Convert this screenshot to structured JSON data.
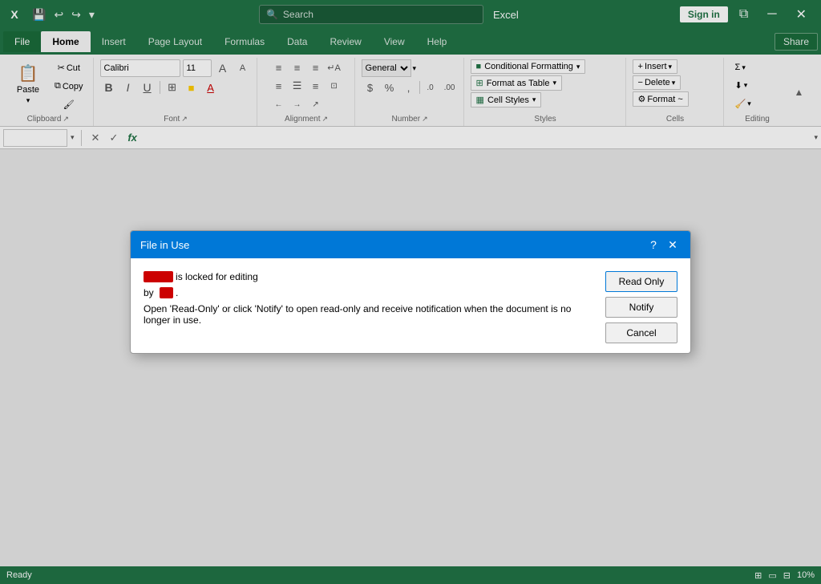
{
  "titlebar": {
    "app_name": "Excel",
    "save_icon": "💾",
    "undo_icon": "↩",
    "redo_icon": "↪",
    "dropdown_icon": "▾",
    "search_placeholder": "Search",
    "sign_in_label": "Sign in",
    "restore_icon": "⧉",
    "minimize_icon": "─",
    "close_icon": "✕"
  },
  "ribbon": {
    "tabs": [
      {
        "label": "File",
        "active": false
      },
      {
        "label": "Home",
        "active": true
      },
      {
        "label": "Insert",
        "active": false
      },
      {
        "label": "Page Layout",
        "active": false
      },
      {
        "label": "Formulas",
        "active": false
      },
      {
        "label": "Data",
        "active": false
      },
      {
        "label": "Review",
        "active": false
      },
      {
        "label": "View",
        "active": false
      },
      {
        "label": "Help",
        "active": false
      }
    ],
    "groups": {
      "clipboard": {
        "label": "Clipboard",
        "paste_label": "Paste",
        "cut_label": "Cut",
        "copy_label": "Copy",
        "format_painter_label": "Format Painter"
      },
      "font": {
        "label": "Font",
        "font_name_placeholder": "Calibri",
        "font_size_placeholder": "11",
        "bold_label": "B",
        "italic_label": "I",
        "underline_label": "U",
        "border_label": "⊞",
        "fill_label": "A",
        "color_label": "A"
      },
      "alignment": {
        "label": "Alignment"
      },
      "number": {
        "label": "Number"
      },
      "styles": {
        "label": "Styles",
        "conditional_formatting": "Conditional Formatting",
        "format_as_table": "Format as Table",
        "cell_styles": "Cell Styles"
      },
      "cells": {
        "label": "Cells",
        "insert_label": "Insert",
        "delete_label": "Delete",
        "format_label": "Format ~"
      },
      "editing": {
        "label": "Editing"
      }
    }
  },
  "formula_bar": {
    "name_box_value": "",
    "cancel_icon": "✕",
    "confirm_icon": "✓",
    "function_icon": "fx"
  },
  "dialog": {
    "title": "File in Use",
    "help_icon": "?",
    "close_icon": "✕",
    "locked_text": "is locked for editing",
    "by_label": "by",
    "redacted_name": "██████",
    "redacted_user": "█████",
    "message": "Open 'Read-Only' or click 'Notify' to open read-only and receive notification when the document is no longer in use.",
    "read_only_btn": "Read Only",
    "notify_btn": "Notify",
    "cancel_btn": "Cancel"
  },
  "statusbar": {
    "status": "Ready",
    "grid_icon": "⊞",
    "page_icon": "▭",
    "preview_icon": "⊟",
    "zoom": "10%"
  }
}
